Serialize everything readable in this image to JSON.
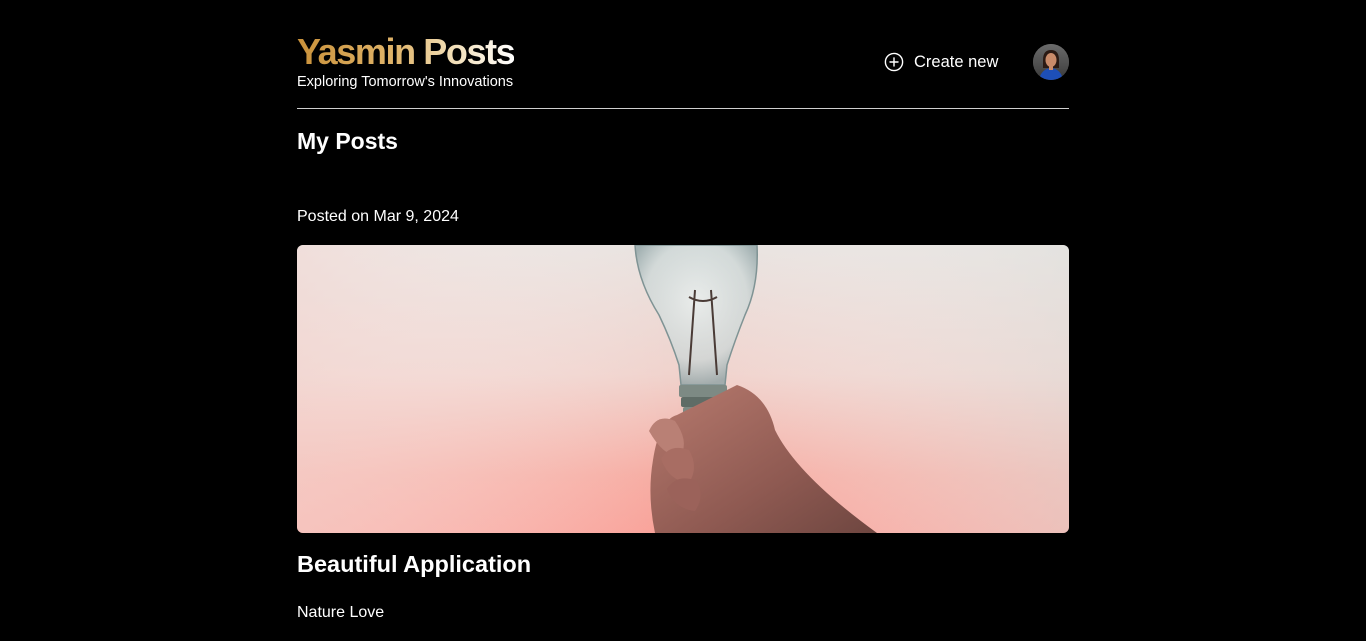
{
  "header": {
    "brand_title": "Yasmin Posts",
    "brand_tagline": "Exploring Tomorrow's Innovations",
    "create_new_label": "Create new",
    "create_new_icon": "plus-circle-icon",
    "avatar_icon": "user-avatar"
  },
  "colors": {
    "background": "#000000",
    "brand_gradient_start": "#c9913a",
    "brand_gradient_end": "#ffffff",
    "text": "#ffffff",
    "divider": "#cfcfcf"
  },
  "main": {
    "section_title": "My Posts",
    "posts": [
      {
        "date": "Posted on Mar 9, 2024",
        "image_alt": "light-bulb-photo",
        "title": "Beautiful Application",
        "category": "Nature Love"
      }
    ]
  }
}
